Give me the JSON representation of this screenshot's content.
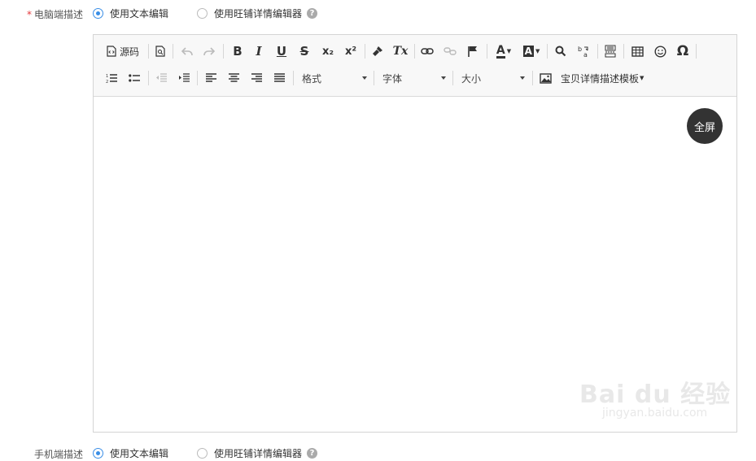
{
  "pc": {
    "label": "电脑端描述",
    "required_mark": "*",
    "option_text_editor": "使用文本编辑",
    "option_wangpu_editor": "使用旺铺详情编辑器",
    "help": "?"
  },
  "toolbar": {
    "source": "源码",
    "bold": "B",
    "italic": "I",
    "underline": "U",
    "strike": "S",
    "subscript": "x₂",
    "superscript": "x²",
    "clear_format": "Tx",
    "text_color": "A",
    "bg_color": "A",
    "special_char": "Ω",
    "format_label": "格式",
    "font_label": "字体",
    "size_label": "大小",
    "template_label": "宝贝详情描述模板"
  },
  "fullscreen_button": "全屏",
  "mobile": {
    "label": "手机端描述",
    "option_text_editor": "使用文本编辑",
    "option_wangpu_editor": "使用旺铺详情编辑器",
    "help": "?"
  },
  "watermark": {
    "brand": "Bai du 经验",
    "url": "jingyan.baidu.com"
  },
  "colors": {
    "accent": "#3a8ee6",
    "required": "#e4393c",
    "fullscreen_bg": "#333333"
  }
}
